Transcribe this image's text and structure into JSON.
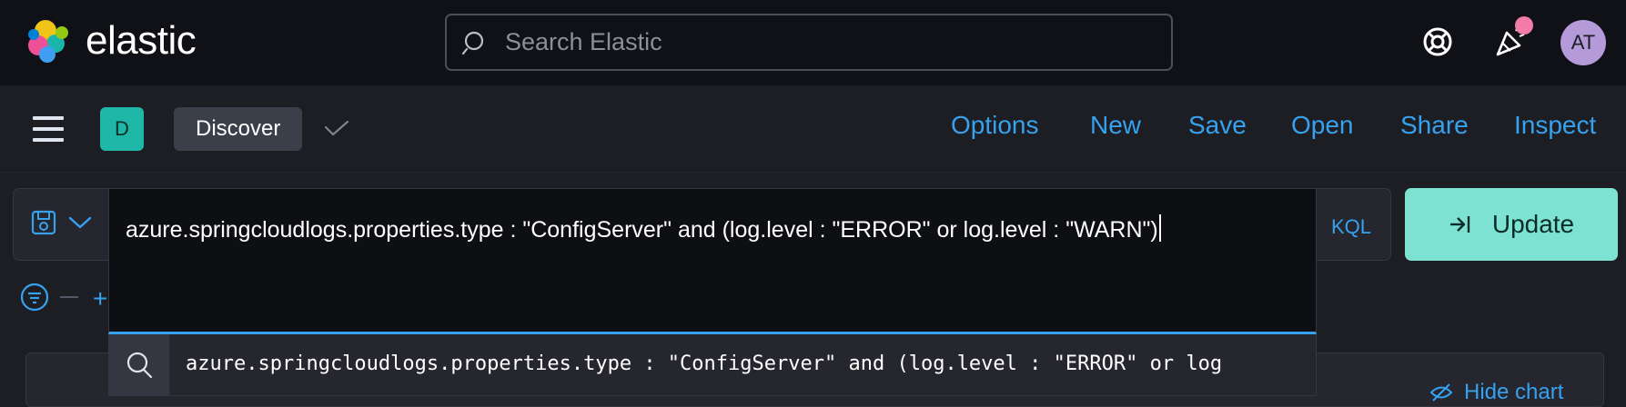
{
  "header": {
    "logo_text": "elastic",
    "search": {
      "placeholder": "Search Elastic",
      "value": ""
    },
    "avatar_initials": "AT",
    "icons": [
      "help-icon",
      "newsfeed-icon",
      "avatar"
    ]
  },
  "app_bar": {
    "space_initial": "D",
    "breadcrumb": "Discover",
    "nav": [
      {
        "label": "Options"
      },
      {
        "label": "New"
      },
      {
        "label": "Save"
      },
      {
        "label": "Open"
      },
      {
        "label": "Share"
      },
      {
        "label": "Inspect"
      }
    ]
  },
  "query": {
    "language": "KQL",
    "text": "azure.springcloudlogs.properties.type : \"ConfigServer\" and (log.level : \"ERROR\" or log.level : \"WARN\")",
    "suggestion": "azure.springcloudlogs.properties.type : \"ConfigServer\" and (log.level : \"ERROR\" or log",
    "update_label": "Update"
  },
  "filters": {
    "add_symbol": "+"
  },
  "background": {
    "hide_chart_label": "Hide chart"
  },
  "colors": {
    "accent": "#36a2ef",
    "update_button": "#7de2d1",
    "space_badge": "#1fb8a8",
    "avatar": "#b59ad9",
    "notification_dot": "#f37ba7"
  }
}
